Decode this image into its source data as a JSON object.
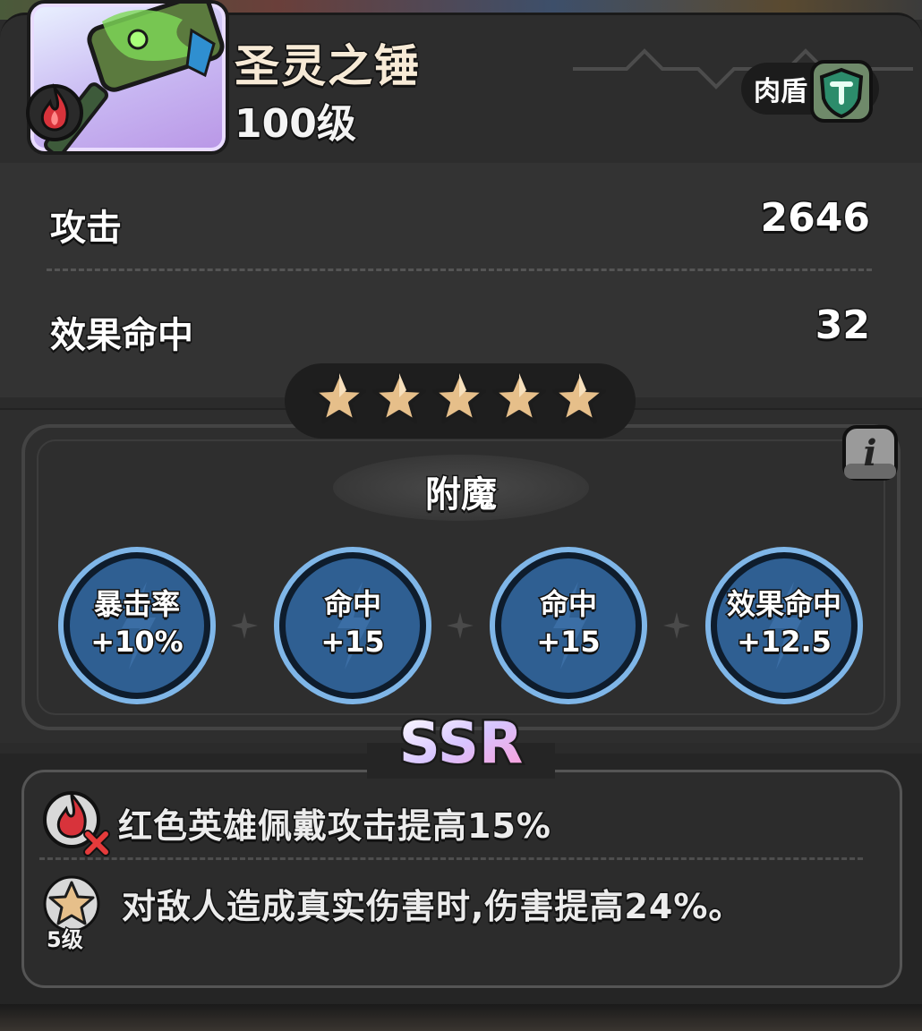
{
  "item": {
    "name": "圣灵之锤",
    "level": "100级",
    "role_tag": "肉盾",
    "element_icon": "red-fire-icon",
    "role_icon": "green-shield-icon"
  },
  "stats": [
    {
      "label": "攻击",
      "value": "2646"
    },
    {
      "label": "效果命中",
      "value": "32"
    }
  ],
  "stars": {
    "filled": 5,
    "total": 5
  },
  "enchant": {
    "title": "附魔",
    "runes": [
      {
        "name": "暴击率",
        "value": "+10%"
      },
      {
        "name": "命中",
        "value": "+15"
      },
      {
        "name": "命中",
        "value": "+15"
      },
      {
        "name": "效果命中",
        "value": "+12.5"
      }
    ]
  },
  "rarity": "SSR",
  "effects": [
    {
      "icon": "red-fire-crossed-icon",
      "text": "红色英雄佩戴攻击提高15%"
    },
    {
      "icon": "star-icon",
      "level": "5级",
      "text": "对敌人造成真实伤害时,伤害提高24%。"
    }
  ],
  "colors": {
    "panel": "#333333",
    "rune_blue": "#2f5f92",
    "rune_rim": "#7fb6e8",
    "star_gold": "#e7c08c"
  }
}
